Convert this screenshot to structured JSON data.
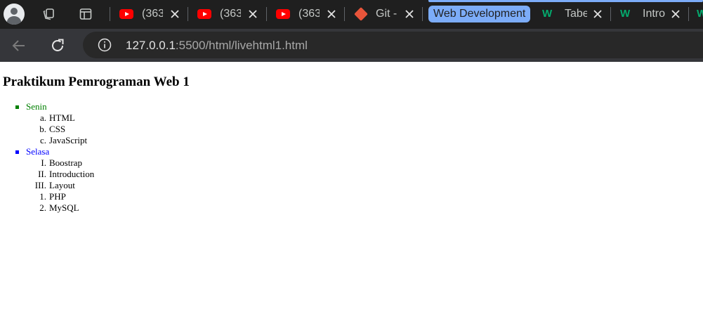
{
  "browser": {
    "tabs": [
      {
        "icon": "youtube-icon",
        "label": "(363"
      },
      {
        "icon": "youtube-icon",
        "label": "(363"
      },
      {
        "icon": "youtube-icon",
        "label": "(363"
      },
      {
        "icon": "git-icon",
        "label": "Git -"
      },
      {
        "icon": "w3schools-icon",
        "label": "Tabe"
      },
      {
        "icon": "w3schools-icon",
        "label": "Intro"
      }
    ],
    "group_label": "Web Development",
    "w_glyph": "W",
    "url_host": "127.0.0.1",
    "url_rest": ":5500/html/livehtml1.html",
    "colors": {
      "group": "#7cacf8",
      "youtube": "#ff0000",
      "w3schools": "#04aa6d"
    }
  },
  "page": {
    "title": "Praktikum Pemrograman Web 1",
    "lists": [
      {
        "day": "Senin",
        "color": "#008000",
        "items": [
          {
            "marker": "a.",
            "text": "HTML"
          },
          {
            "marker": "b.",
            "text": "CSS"
          },
          {
            "marker": "c.",
            "text": "JavaScript"
          }
        ]
      },
      {
        "day": "Selasa",
        "color": "#0000ff",
        "items": [
          {
            "marker": "I.",
            "text": "Boostrap"
          },
          {
            "marker": "II.",
            "text": "Introduction"
          },
          {
            "marker": "III.",
            "text": "Layout"
          },
          {
            "marker": "1.",
            "text": "PHP"
          },
          {
            "marker": "2.",
            "text": "MySQL"
          }
        ]
      }
    ]
  }
}
